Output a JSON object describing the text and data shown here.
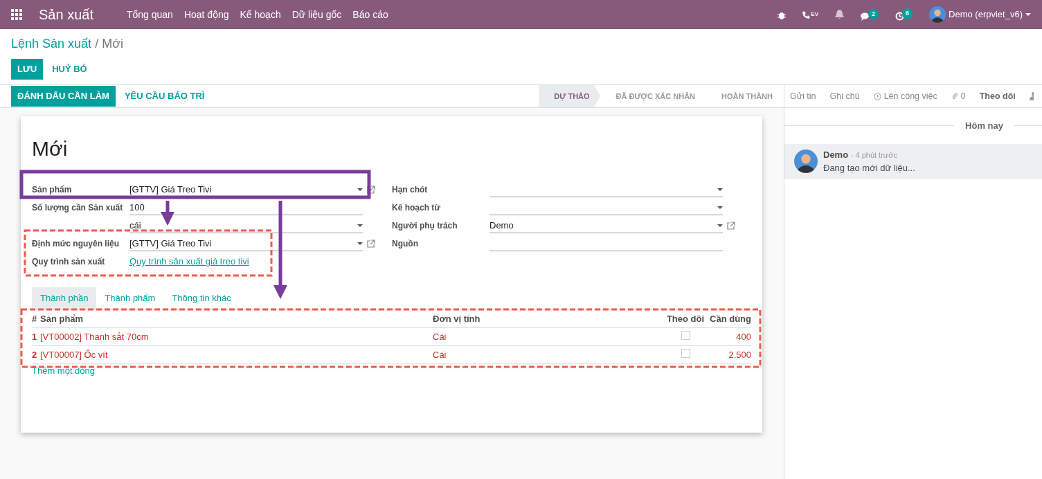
{
  "navbar": {
    "app_title": "Sản xuất",
    "menu": [
      "Tổng quan",
      "Hoạt động",
      "Kế hoạch",
      "Dữ liệu gốc",
      "Báo cáo"
    ],
    "call_label": "EV",
    "messages_count": "2",
    "activities_count": "6",
    "user": "Demo (erpviet_v6)"
  },
  "breadcrumb": {
    "parent": "Lệnh Sản xuất",
    "separator": "/",
    "current": "Mới"
  },
  "actions": {
    "save": "LƯU",
    "discard": "HUỶ BỎ"
  },
  "header_buttons": [
    {
      "label": "ĐÁNH DẤU CẦN LÀM",
      "primary": true
    },
    {
      "label": "YÊU CẦU BẢO TRÌ",
      "primary": false
    }
  ],
  "stages": [
    {
      "label": "DỰ THẢO",
      "selected": true
    },
    {
      "label": "ĐÃ ĐƯỢC XÁC NHẬN",
      "selected": false
    },
    {
      "label": "HOÀN THÀNH",
      "selected": false
    }
  ],
  "chatter": {
    "actions": [
      {
        "label": "Gửi tin",
        "kind": "text"
      },
      {
        "label": "Ghi chú",
        "kind": "text"
      },
      {
        "label": "Lên công việc",
        "kind": "clock"
      },
      {
        "label": "0",
        "kind": "clip"
      },
      {
        "label": "Theo dõi",
        "kind": "bold"
      }
    ],
    "day": "Hôm nay",
    "messages": [
      {
        "author": "Demo",
        "time": "- 4 phút trước",
        "body": "Đang tạo mới dữ liệu..."
      }
    ]
  },
  "form": {
    "title": "Mới",
    "left_fields": [
      {
        "label": "Sản phẩm",
        "value": "[GTTV] Giá Treo Tivi",
        "kind": "select",
        "external": true
      },
      {
        "label": "Số lượng cần Sản xuất",
        "value": "100",
        "kind": "input",
        "external": false
      },
      {
        "value": "cái",
        "kind": "select",
        "external": false
      },
      {
        "label": "Định mức nguyên liệu",
        "value": "[GTTV] Giá Treo Tivi",
        "kind": "select",
        "external": true
      },
      {
        "label": "Quy trình sản xuất",
        "value": "Quy trình sản xuất giá treo tivi",
        "kind": "link",
        "external": false
      }
    ],
    "right_fields": [
      {
        "label": "Hạn chót",
        "kind": "select",
        "external": false
      },
      {
        "label": "Kế hoạch từ",
        "kind": "select",
        "external": false
      },
      {
        "label": "Người phụ trách",
        "value": "Demo",
        "kind": "select",
        "external": true
      },
      {
        "label": "Nguồn",
        "kind": "input",
        "external": false
      }
    ],
    "tabs": [
      {
        "label": "Thành phần",
        "selected": true
      },
      {
        "label": "Thành phẩm",
        "selected": false
      },
      {
        "label": "Thông tin khác",
        "selected": false
      }
    ],
    "table": {
      "columns": [
        "#",
        "Sản phẩm",
        "Đơn vị tính",
        "Theo dõi",
        "Cần dùng"
      ],
      "rows": [
        {
          "index": "1",
          "product": "[VT00002] Thanh sắt 70cm",
          "unit": "Cái",
          "tracked": false,
          "quantity": "400"
        },
        {
          "index": "2",
          "product": "[VT00007] Ốc vít",
          "unit": "Cái",
          "tracked": false,
          "quantity": "2.500"
        }
      ],
      "add_line": "Thêm một dòng"
    }
  }
}
